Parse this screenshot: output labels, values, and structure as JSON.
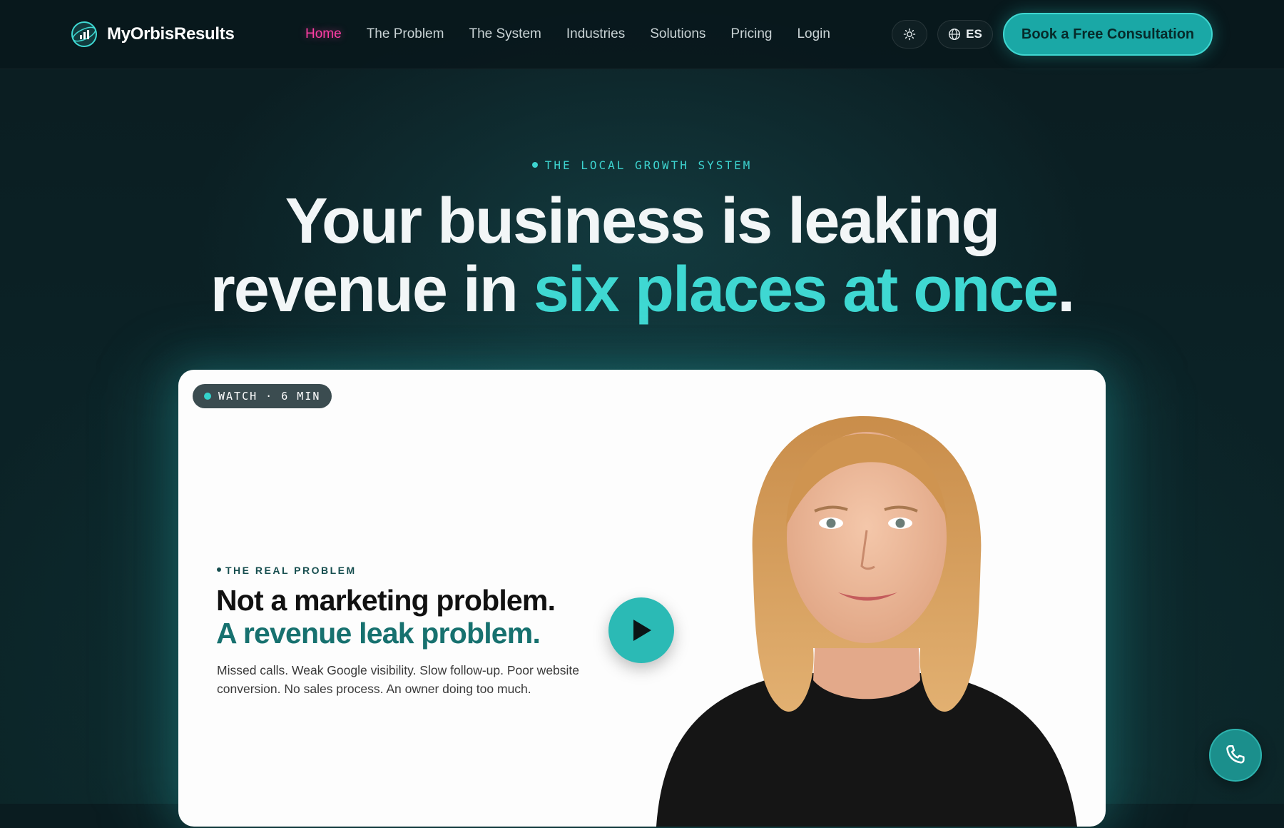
{
  "nav": {
    "brand": "MyOrbisResults",
    "links": [
      {
        "label": "Home",
        "active": true
      },
      {
        "label": "The Problem"
      },
      {
        "label": "The System"
      },
      {
        "label": "Industries"
      },
      {
        "label": "Solutions"
      },
      {
        "label": "Pricing"
      },
      {
        "label": "Login"
      }
    ],
    "theme_icon": "sun-icon",
    "language": "ES",
    "language_icon": "globe-icon",
    "cta": "Book a Free Consultation"
  },
  "hero": {
    "eyebrow": "THE LOCAL GROWTH SYSTEM",
    "headline_line1": "Your business is leaking",
    "headline_line2_start": "revenue in ",
    "headline_accent": "six places at once",
    "headline_end": "."
  },
  "video": {
    "badge": "WATCH · 6 MIN",
    "eyebrow": "THE REAL PROBLEM",
    "title_line1": "Not a marketing problem.",
    "title_line2": "A revenue leak problem.",
    "body": "Missed calls. Weak Google visibility. Slow follow-up. Poor website conversion. No sales process. An owner doing too much.",
    "play_icon": "play-icon"
  },
  "fab": {
    "icon": "phone-icon"
  },
  "colors": {
    "background": "#0a1c20",
    "accent": "#3fd8d2",
    "cta": "#1aa8a6",
    "active_link": "#ff3ea5",
    "video_accent": "#17716f"
  }
}
